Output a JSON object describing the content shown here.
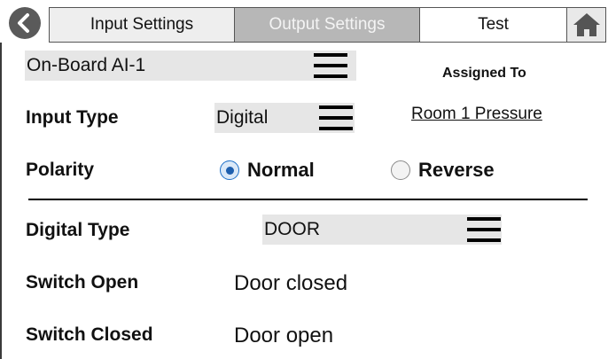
{
  "tabs": {
    "input": "Input Settings",
    "output": "Output Settings",
    "test": "Test"
  },
  "source_select": {
    "value": "On-Board AI-1"
  },
  "assigned": {
    "title": "Assigned To",
    "link": "Room 1 Pressure"
  },
  "input_type": {
    "label": "Input Type",
    "value": "Digital"
  },
  "polarity": {
    "label": "Polarity",
    "options": [
      "Normal",
      "Reverse"
    ],
    "selected": "Normal"
  },
  "digital_type": {
    "label": "Digital Type",
    "value": "DOOR"
  },
  "switch_open": {
    "label": "Switch Open",
    "value": "Door closed"
  },
  "switch_closed": {
    "label": "Switch Closed",
    "value": "Door open"
  },
  "icons": {
    "back": "chevron-left-icon",
    "home": "home-icon",
    "menu": "hamburger-menu-icon"
  },
  "colors": {
    "active_tab": "#eeeeee",
    "disabled_tab": "#b7b7b7",
    "select_bg": "#e6e6e6",
    "radio_accent": "#1e5fae"
  }
}
